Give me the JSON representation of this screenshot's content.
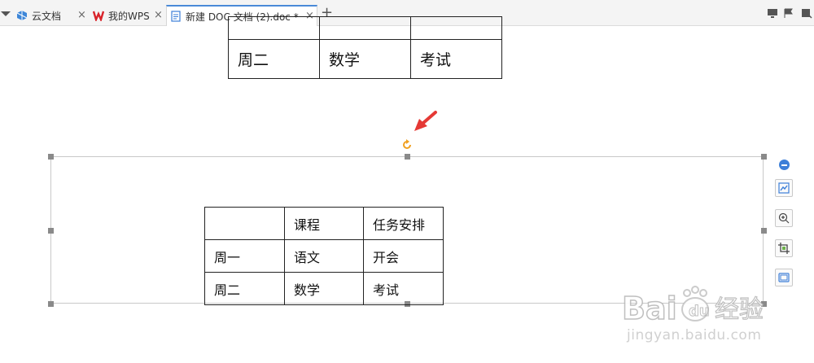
{
  "tabs": [
    {
      "label": "云文档",
      "close": "×"
    },
    {
      "label": "我的WPS",
      "close": "×"
    },
    {
      "label": "新建 DOC 文档 (2).doc *",
      "close": "×"
    }
  ],
  "add_tab": "+",
  "top_table": {
    "rows": [
      [
        "",
        "",
        ""
      ],
      [
        "周二",
        "数学",
        "考试"
      ]
    ]
  },
  "main_table": {
    "rows": [
      [
        "",
        "课程",
        "任务安排"
      ],
      [
        "周一",
        "语文",
        "开会"
      ],
      [
        "周二",
        "数学",
        "考试"
      ]
    ]
  },
  "side_toolbar": [
    "minus-icon",
    "chart-icon",
    "zoom-icon",
    "crop-icon",
    "frame-icon"
  ],
  "watermark": {
    "logo": "Baidu 经验",
    "url": "jingyan.baidu.com"
  },
  "colors": {
    "accent": "#4a8ad8",
    "arrow": "#e53935",
    "rotate": "#f0a020"
  }
}
